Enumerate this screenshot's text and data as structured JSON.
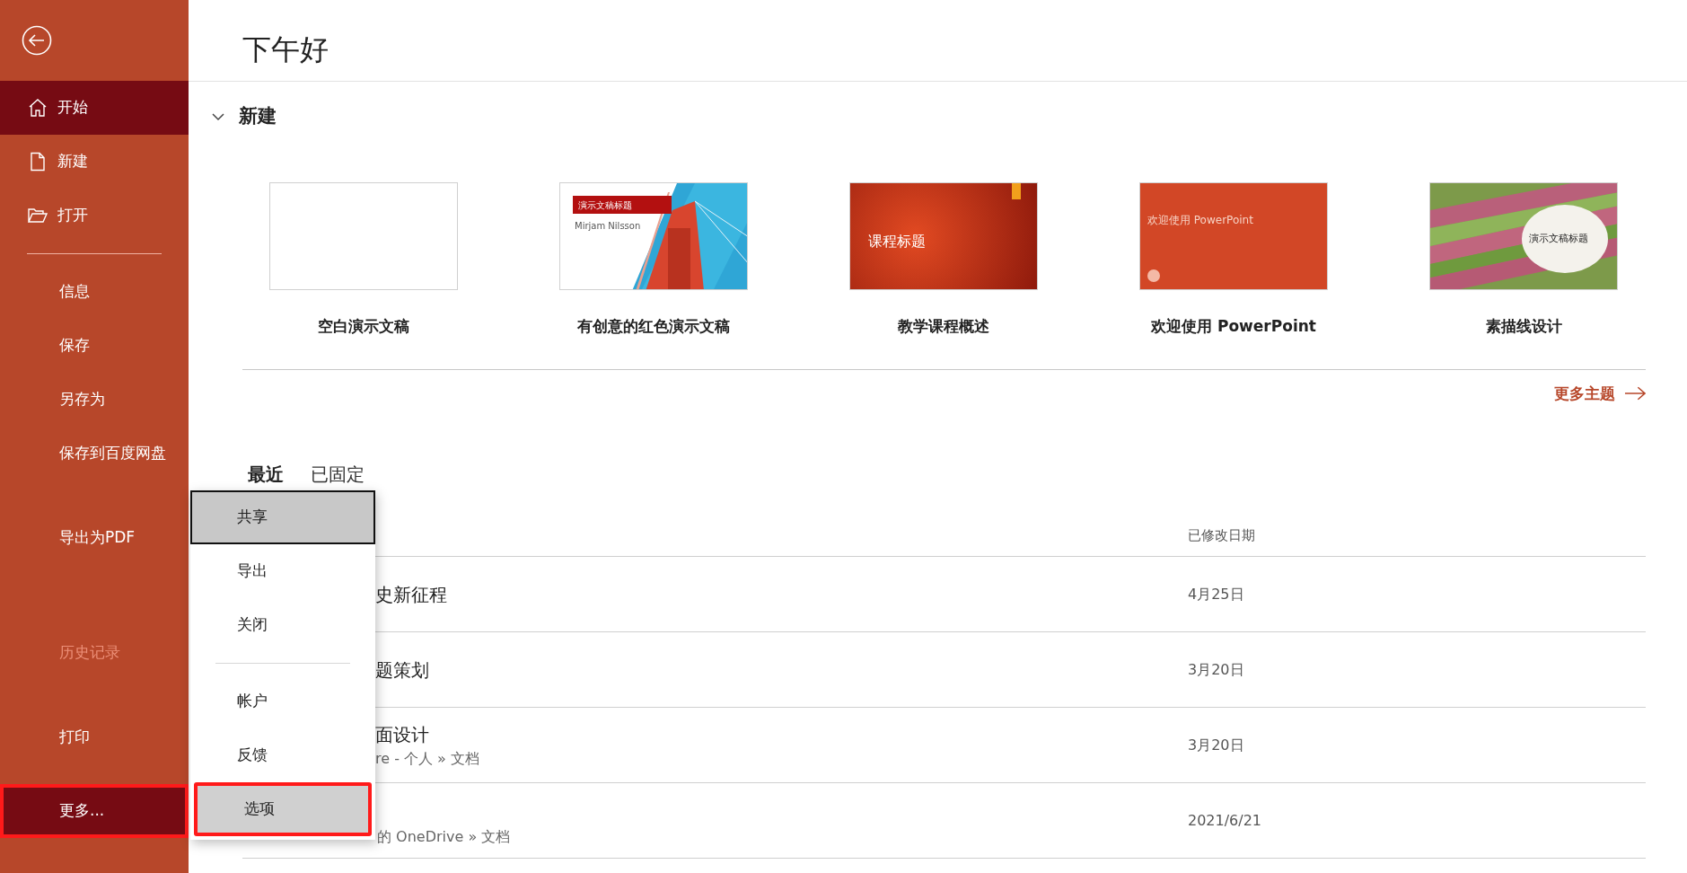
{
  "sidebar": {
    "items": [
      {
        "label": "开始",
        "selected": true,
        "disabled": false,
        "annotated": false
      },
      {
        "label": "新建",
        "selected": false,
        "disabled": false,
        "annotated": false
      },
      {
        "label": "打开",
        "selected": false,
        "disabled": false,
        "annotated": false
      },
      {
        "label": "信息",
        "selected": false,
        "disabled": false,
        "annotated": false
      },
      {
        "label": "保存",
        "selected": false,
        "disabled": false,
        "annotated": false
      },
      {
        "label": "另存为",
        "selected": false,
        "disabled": false,
        "annotated": false
      },
      {
        "label": "保存到百度网盘",
        "selected": false,
        "disabled": false,
        "annotated": false
      },
      {
        "label": "导出为PDF",
        "selected": false,
        "disabled": false,
        "annotated": false
      },
      {
        "label": "历史记录",
        "selected": false,
        "disabled": true,
        "annotated": false
      },
      {
        "label": "打印",
        "selected": false,
        "disabled": false,
        "annotated": false
      },
      {
        "label": "更多...",
        "selected": true,
        "disabled": false,
        "annotated": true
      }
    ]
  },
  "header": {
    "greeting": "下午好"
  },
  "new_section": {
    "title": "新建",
    "expanded": true,
    "templates": [
      {
        "kind": "blank",
        "name": "空白演示文稿"
      },
      {
        "kind": "bridge",
        "name": "有创意的红色演示文稿",
        "thumb_title": "演示文稿标题",
        "thumb_subtitle": "Mirjam Nilsson"
      },
      {
        "kind": "gradient",
        "name": "教学课程概述",
        "thumb_title": "课程标题"
      },
      {
        "kind": "welcome",
        "name": "欢迎使用 PowerPoint",
        "thumb_title": "欢迎使用 PowerPoint"
      },
      {
        "kind": "field",
        "name": "素描线设计",
        "thumb_title": "演示文稿标题"
      }
    ],
    "more_link": "更多主题"
  },
  "recent": {
    "tabs": [
      {
        "label": "最近",
        "selected": true
      },
      {
        "label": "已固定",
        "selected": false
      }
    ],
    "column_header": "已修改日期",
    "rows": [
      {
        "name": "史新征程",
        "date": "4月25日"
      },
      {
        "name": "题策划",
        "date": "3月20日"
      },
      {
        "name": "面设计",
        "location": "re - 个人 » 文档",
        "date": "3月20日"
      },
      {
        "location": "的 OneDrive » 文档",
        "date": "2021/6/21"
      }
    ]
  },
  "more_menu": {
    "items": [
      {
        "kind": "item",
        "label": "共享",
        "selected": true,
        "annotated": false
      },
      {
        "kind": "item",
        "label": "导出",
        "selected": false,
        "annotated": false
      },
      {
        "kind": "item",
        "label": "关闭",
        "selected": false,
        "annotated": false
      },
      {
        "kind": "divider"
      },
      {
        "kind": "item",
        "label": "帐户",
        "selected": false,
        "annotated": false
      },
      {
        "kind": "item",
        "label": "反馈",
        "selected": false,
        "annotated": false
      },
      {
        "kind": "item",
        "label": "选项",
        "selected": false,
        "annotated": true
      }
    ]
  }
}
